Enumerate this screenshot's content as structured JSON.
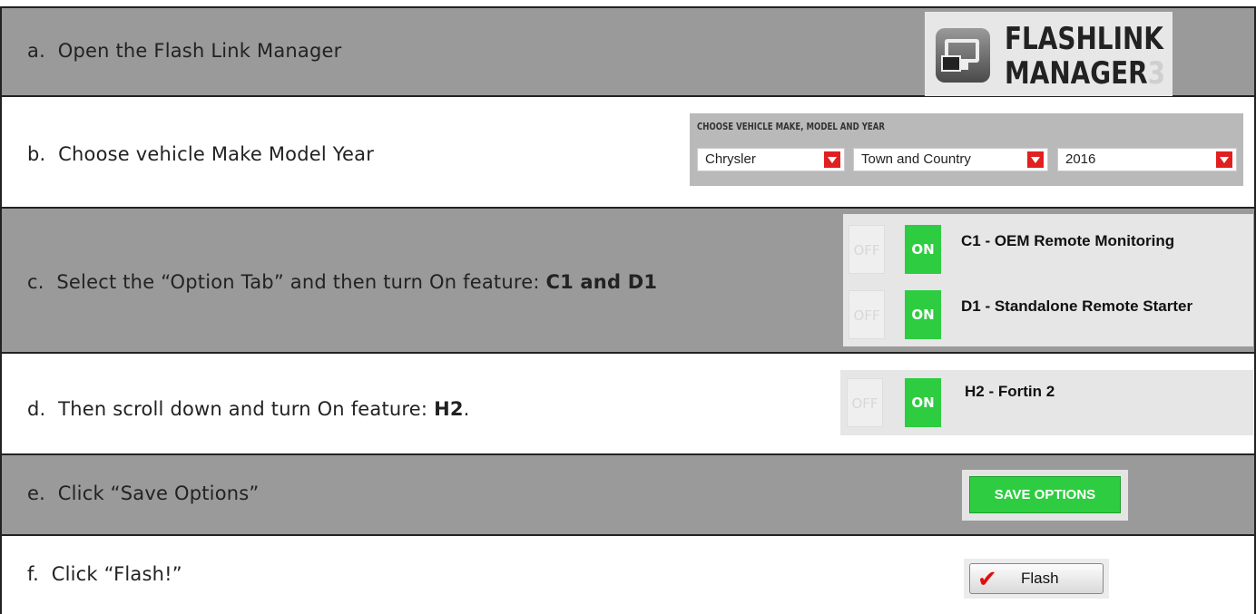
{
  "steps": [
    {
      "prefix": "a.",
      "text": "Open the Flash Link Manager",
      "bold": ""
    },
    {
      "prefix": "b.",
      "text": "Choose vehicle Make Model Year",
      "bold": ""
    },
    {
      "prefix": "c.",
      "text": "Select the “Option Tab” and then turn On feature: ",
      "bold": "C1 and D1"
    },
    {
      "prefix": "d.",
      "text": "Then scroll down and turn On feature: ",
      "bold": "H2",
      "suffix": "."
    },
    {
      "prefix": "e.",
      "text": "Click “Save Options”",
      "bold": ""
    },
    {
      "prefix": "f.",
      "text": "Click “Flash!”",
      "bold": ""
    }
  ],
  "logo": {
    "line1": "FLASHLINK",
    "line2": "MANAGER",
    "line2_suffix": "3"
  },
  "chooser": {
    "title": "CHOOSE VEHICLE MAKE, MODEL AND YEAR",
    "make": "Chrysler",
    "model": "Town and Country",
    "year": "2016"
  },
  "options": [
    {
      "off": "OFF",
      "on": "ON",
      "label": "C1 - OEM Remote Monitoring",
      "state": "on"
    },
    {
      "off": "OFF",
      "on": "ON",
      "label": "D1 - Standalone Remote Starter",
      "state": "on"
    },
    {
      "off": "OFF",
      "on": "ON",
      "label": "H2 - Fortin 2",
      "state": "on"
    }
  ],
  "save_button": "SAVE OPTIONS",
  "flash_button": "Flash",
  "colors": {
    "row_gray": "#9a9a9a",
    "toggle_on": "#2ecc40",
    "dropdown_arrow": "#e02020",
    "check": "#dd1111"
  }
}
